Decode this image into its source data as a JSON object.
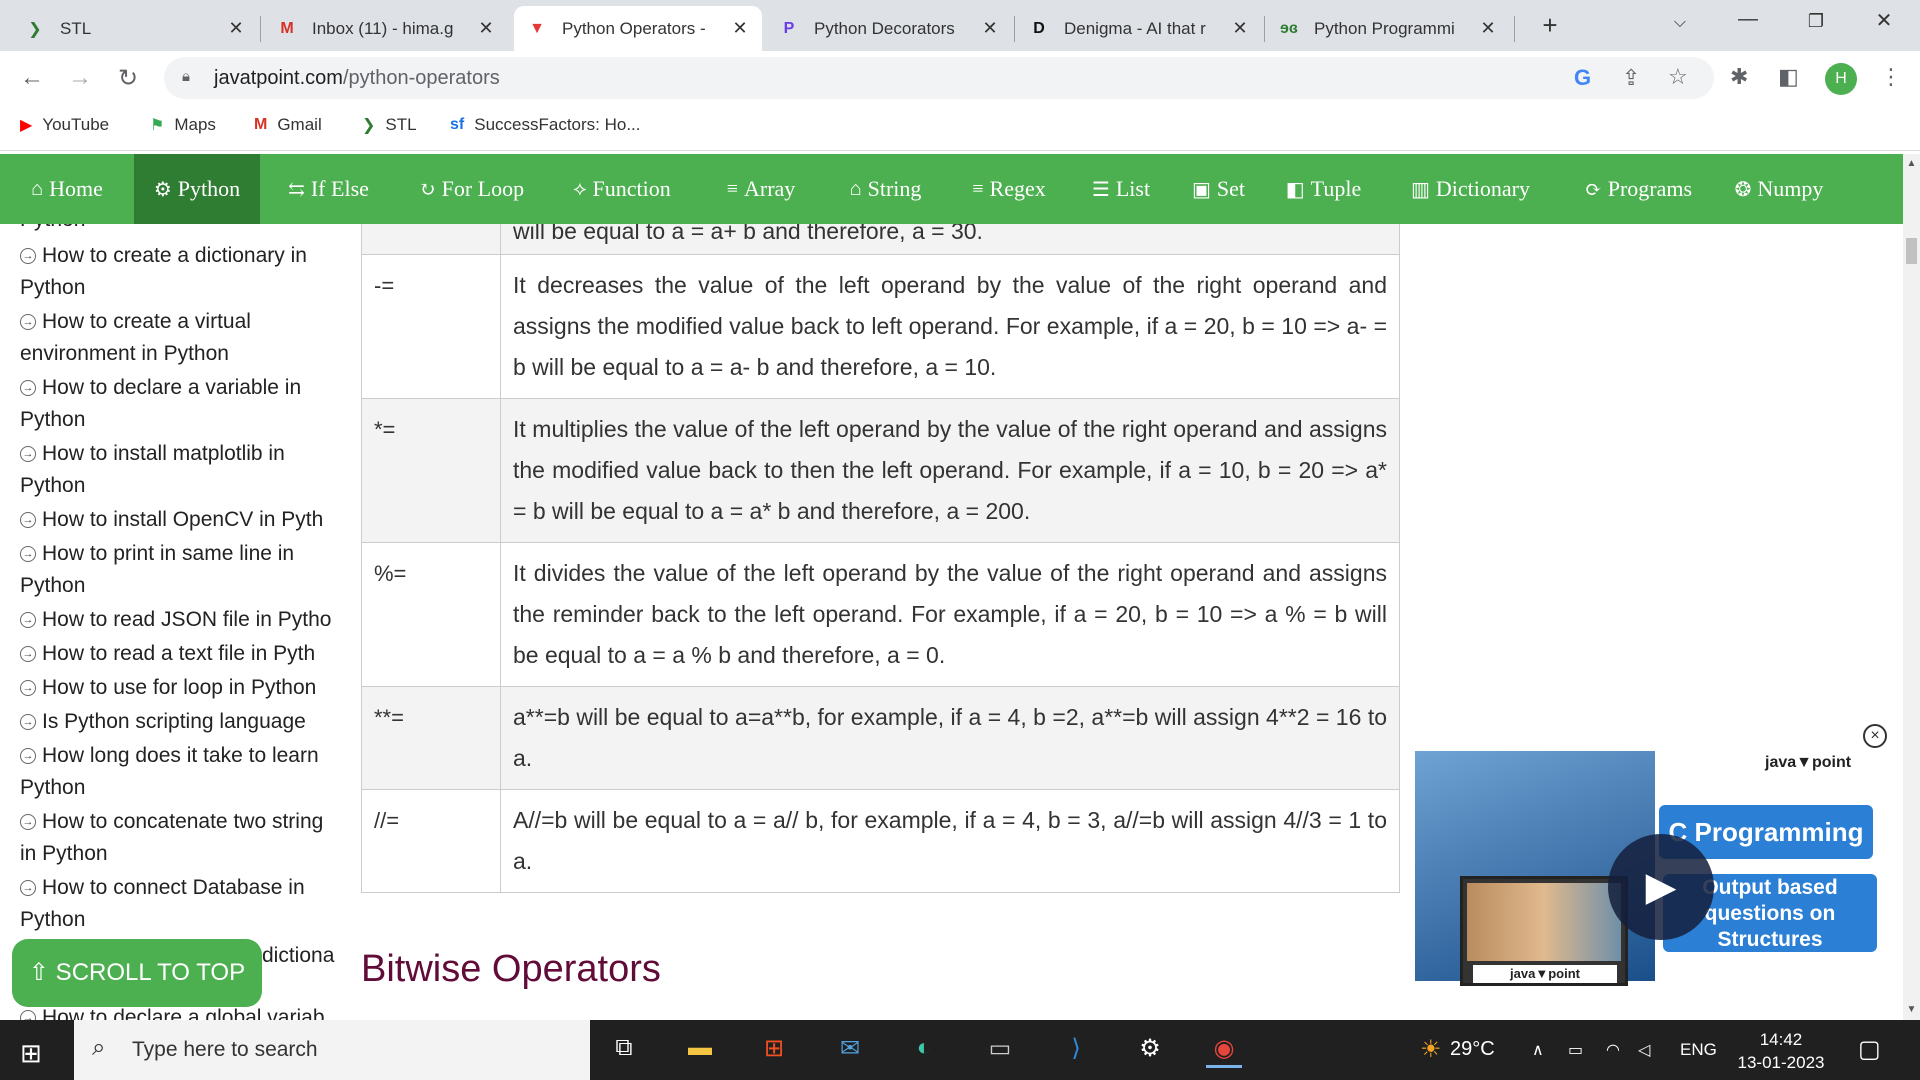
{
  "tabs": [
    {
      "favicon": "stl-icon",
      "glyph": "❯",
      "color": "#2e7d32",
      "title": "STL",
      "active": false
    },
    {
      "favicon": "gmail-icon",
      "glyph": "M",
      "color": "#d93025",
      "title": "Inbox (11) - hima.g",
      "active": false
    },
    {
      "favicon": "javatpoint-icon",
      "glyph": "▼",
      "color": "#e53935",
      "title": "Python Operators -",
      "active": true
    },
    {
      "favicon": "ptrace-icon",
      "glyph": "P",
      "color": "#6a3de8",
      "title": "Python Decorators",
      "active": false
    },
    {
      "favicon": "denigma-icon",
      "glyph": "D",
      "color": "#111111",
      "title": "Denigma - AI that r",
      "active": false
    },
    {
      "favicon": "gfg-icon",
      "glyph": "ɘɞ",
      "color": "#2e7d32",
      "title": "Python Programmi",
      "active": false
    }
  ],
  "toolbar": {
    "url_host": "javatpoint.com",
    "url_path": "/python-operators",
    "avatar_letter": "H"
  },
  "bookmarks": [
    {
      "icon": "youtube-icon",
      "glyph": "▶",
      "color": "#ff0000",
      "label": "YouTube"
    },
    {
      "icon": "maps-icon",
      "glyph": "⚑",
      "color": "#34a853",
      "label": "Maps"
    },
    {
      "icon": "gmail-icon",
      "glyph": "M",
      "color": "#d93025",
      "label": "Gmail"
    },
    {
      "icon": "stl-icon",
      "glyph": "❯",
      "color": "#2e7d32",
      "label": "STL"
    },
    {
      "icon": "successfactors-icon",
      "glyph": "sf",
      "color": "#1a73e8",
      "label": "SuccessFactors: Ho..."
    }
  ],
  "site_nav": [
    {
      "icon": "home-icon",
      "glyph": "⌂",
      "label": "Home",
      "active": false
    },
    {
      "icon": "python-icon",
      "glyph": "⚙",
      "label": "Python",
      "active": true
    },
    {
      "icon": "if-else-icon",
      "glyph": "⇆",
      "label": "If Else",
      "active": false
    },
    {
      "icon": "for-loop-icon",
      "glyph": "↻",
      "label": "For Loop",
      "active": false
    },
    {
      "icon": "function-icon",
      "glyph": "⟡",
      "label": "Function",
      "active": false
    },
    {
      "icon": "array-icon",
      "glyph": "≡",
      "label": "Array",
      "active": false
    },
    {
      "icon": "string-icon",
      "glyph": "⌂",
      "label": "String",
      "active": false
    },
    {
      "icon": "regex-icon",
      "glyph": "≡",
      "label": "Regex",
      "active": false
    },
    {
      "icon": "list-icon",
      "glyph": "☰",
      "label": "List",
      "active": false
    },
    {
      "icon": "set-icon",
      "glyph": "▣",
      "label": "Set",
      "active": false
    },
    {
      "icon": "tuple-icon",
      "glyph": "◧",
      "label": "Tuple",
      "active": false
    },
    {
      "icon": "dictionary-icon",
      "glyph": "▥",
      "label": "Dictionary",
      "active": false
    },
    {
      "icon": "programs-icon",
      "glyph": "⟳",
      "label": "Programs",
      "active": false
    },
    {
      "icon": "numpy-icon",
      "glyph": "❂",
      "label": "Numpy",
      "active": false
    }
  ],
  "sidebar": {
    "items": [
      {
        "label": "Python",
        "marker": false
      },
      {
        "label": "How to create a dictionary in",
        "marker": true
      },
      {
        "label": "Python",
        "marker": false
      },
      {
        "label": "How to create a virtual",
        "marker": true
      },
      {
        "label": "environment in Python",
        "marker": false
      },
      {
        "label": "How to declare a variable in",
        "marker": true
      },
      {
        "label": "Python",
        "marker": false
      },
      {
        "label": "How to install matplotlib in",
        "marker": true
      },
      {
        "label": "Python",
        "marker": false
      },
      {
        "label": "How to install OpenCV in Pyth",
        "marker": true
      },
      {
        "label": "How to print in same line in",
        "marker": true
      },
      {
        "label": "Python",
        "marker": false
      },
      {
        "label": "How to read JSON file in Pytho",
        "marker": true
      },
      {
        "label": "How to read a text file in Pyth",
        "marker": true
      },
      {
        "label": "How to use for loop in Python",
        "marker": true
      },
      {
        "label": "Is Python scripting language",
        "marker": true
      },
      {
        "label": "How long does it take to learn",
        "marker": true
      },
      {
        "label": "Python",
        "marker": false
      },
      {
        "label": "How to concatenate two string",
        "marker": true
      },
      {
        "label": "in Python",
        "marker": false
      },
      {
        "label": "How to connect Database in",
        "marker": true
      },
      {
        "label": "Python",
        "marker": false
      },
      {
        "label": "dictiona",
        "marker": false
      },
      {
        "label": "How to declare a global variab",
        "marker": true
      }
    ]
  },
  "table": {
    "rows": [
      {
        "op": "",
        "desc": "will be equal to a = a+ b and therefore, a = 30.",
        "shaded": true
      },
      {
        "op": "-=",
        "desc": "It decreases the value of the left operand by the value of the right operand and assigns the modified value back to left operand. For example, if a = 20, b = 10 => a- = b will be equal to a = a- b and therefore, a = 10.",
        "shaded": false
      },
      {
        "op": "*=",
        "desc": "It multiplies the value of the left operand by the value of the right operand and assigns the modified value back to then the left operand. For example, if a = 10, b = 20 => a* = b will be equal to a = a* b and therefore, a = 200.",
        "shaded": true
      },
      {
        "op": "%=",
        "desc": "It divides the value of the left operand by the value of the right operand and assigns the reminder back to the left operand. For example, if a = 20, b = 10 => a % = b will be equal to a = a % b and therefore, a = 0.",
        "shaded": false
      },
      {
        "op": "**=",
        "desc": "a**=b will be equal to a=a**b, for example, if a = 4, b =2, a**=b will assign 4**2 = 16 to a.",
        "shaded": true
      },
      {
        "op": "//=",
        "desc": "A//=b will be equal to a = a// b, for example, if a = 4, b = 3, a//=b will assign 4//3 = 1 to a.",
        "shaded": false
      }
    ]
  },
  "section_heading": "Bitwise Operators",
  "scroll_to_top": "⇧ SCROLL TO TOP",
  "ad": {
    "logo": "java▼point",
    "title": "C Programming",
    "subtitle": "Output based questions on Structures",
    "thumb_caption": "java▼point"
  },
  "taskbar": {
    "search_placeholder": "Type here to search",
    "weather": "29°C",
    "language": "ENG",
    "time": "14:42",
    "date": "13-01-2023"
  }
}
